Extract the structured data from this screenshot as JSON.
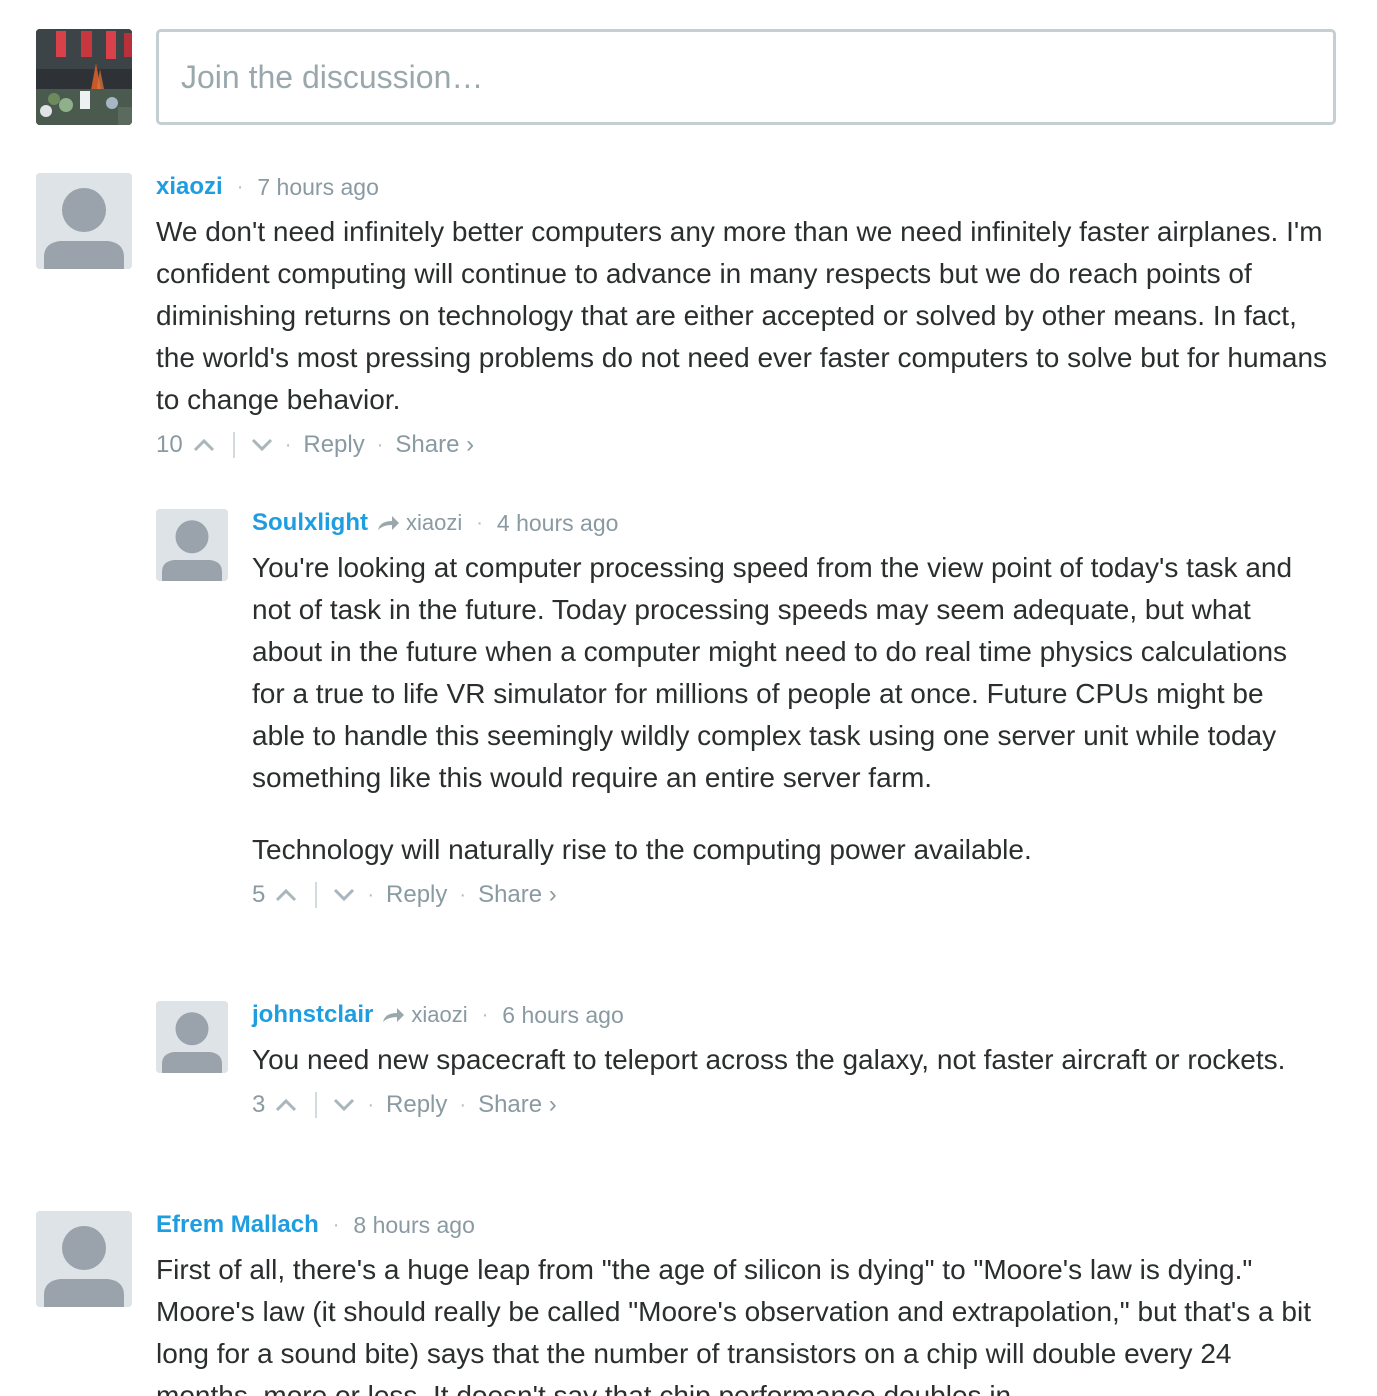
{
  "composer": {
    "placeholder": "Join the discussion…"
  },
  "comments": [
    {
      "author": "xiaozi",
      "time": "7 hours ago",
      "paragraphs": [
        "We don't need infinitely better computers any more than we need infinitely faster airplanes. I'm confident computing will continue to advance in many respects but we do reach points of diminishing returns on technology that are either accepted or solved by other means. In fact, the world's most pressing problems do not need ever faster computers to solve but for humans to change behavior."
      ],
      "votes": "10",
      "reply_label": "Reply",
      "share_label": "Share ›"
    },
    {
      "author": "Soulxlight",
      "in_reply_to": "xiaozi",
      "time": "4 hours ago",
      "paragraphs": [
        "You're looking at computer processing speed from the view point of today's task and not of task in the future. Today processing speeds may seem adequate, but what about in the future when a computer might need to do real time physics calculations for a true to life VR simulator for millions of people at once. Future CPUs might be able to handle this seemingly wildly complex task using one server unit while today something like this would require an entire server farm.",
        "Technology will naturally rise to the computing power available."
      ],
      "votes": "5",
      "reply_label": "Reply",
      "share_label": "Share ›"
    },
    {
      "author": "johnstclair",
      "in_reply_to": "xiaozi",
      "time": "6 hours ago",
      "paragraphs": [
        "You need new spacecraft to teleport across the galaxy, not faster aircraft or rockets."
      ],
      "votes": "3",
      "reply_label": "Reply",
      "share_label": "Share ›"
    },
    {
      "author": "Efrem Mallach",
      "time": "8 hours ago",
      "paragraphs": [
        "First of all, there's a huge leap from \"the age of silicon is dying\" to \"Moore's law is dying.\" Moore's law (it should really be called \"Moore's observation and extrapolation,\" but that's a bit long for a sound bite) says that the number of transistors on a chip will double every 24 months, more or less. It doesn't say that chip performance doubles in"
      ]
    }
  ],
  "separator": "·",
  "colors": {
    "author": "#1e9ee0",
    "meta": "#8a9aa2",
    "text": "#2a2e2e",
    "input_border": "#c4cfd4",
    "avatar_bg": "#dde3e6",
    "avatar_figure": "#9aa3ab"
  },
  "icons": {
    "upvote": "chevron-up-icon",
    "downvote": "chevron-down-icon",
    "reply_to": "reply-arrow-icon",
    "avatar": "default-user-avatar-icon"
  }
}
